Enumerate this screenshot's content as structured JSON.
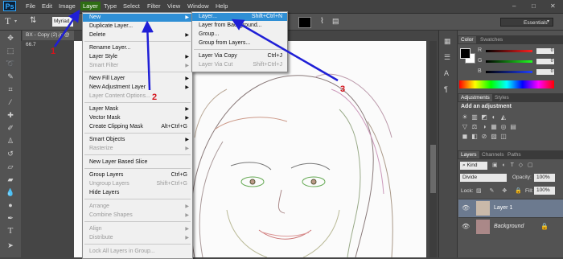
{
  "app": {
    "logo": "Ps"
  },
  "menubar": {
    "items": [
      "File",
      "Edit",
      "Image",
      "Layer",
      "Type",
      "Select",
      "Filter",
      "View",
      "Window",
      "Help"
    ],
    "window_controls": [
      "–",
      "□",
      "✕"
    ]
  },
  "options": {
    "font_value": "Myriad",
    "workspace": "Essentials"
  },
  "document": {
    "tab_label": "BX - Copy (2).jp @ 66.7"
  },
  "layer_menu": {
    "items": [
      {
        "label": "New",
        "shortcut": "",
        "submenu": true,
        "state": "highlight"
      },
      {
        "label": "Duplicate Layer...",
        "shortcut": "",
        "submenu": false,
        "state": "normal"
      },
      {
        "label": "Delete",
        "shortcut": "",
        "submenu": true,
        "state": "normal"
      },
      {
        "label": "Rename Layer...",
        "shortcut": "",
        "submenu": false,
        "state": "normal"
      },
      {
        "label": "Layer Style",
        "shortcut": "",
        "submenu": true,
        "state": "normal"
      },
      {
        "label": "Smart Filter",
        "shortcut": "",
        "submenu": true,
        "state": "disabled"
      },
      {
        "label": "New Fill Layer",
        "shortcut": "",
        "submenu": true,
        "state": "normal"
      },
      {
        "label": "New Adjustment Layer",
        "shortcut": "",
        "submenu": true,
        "state": "normal"
      },
      {
        "label": "Layer Content Options...",
        "shortcut": "",
        "submenu": false,
        "state": "disabled"
      },
      {
        "label": "Layer Mask",
        "shortcut": "",
        "submenu": true,
        "state": "normal"
      },
      {
        "label": "Vector Mask",
        "shortcut": "",
        "submenu": true,
        "state": "normal"
      },
      {
        "label": "Create Clipping Mask",
        "shortcut": "Alt+Ctrl+G",
        "submenu": false,
        "state": "normal"
      },
      {
        "label": "Smart Objects",
        "shortcut": "",
        "submenu": true,
        "state": "normal"
      },
      {
        "label": "Rasterize",
        "shortcut": "",
        "submenu": true,
        "state": "disabled"
      },
      {
        "label": "New Layer Based Slice",
        "shortcut": "",
        "submenu": false,
        "state": "normal"
      },
      {
        "label": "Group Layers",
        "shortcut": "Ctrl+G",
        "submenu": false,
        "state": "normal"
      },
      {
        "label": "Ungroup Layers",
        "shortcut": "Shift+Ctrl+G",
        "submenu": false,
        "state": "disabled"
      },
      {
        "label": "Hide Layers",
        "shortcut": "",
        "submenu": false,
        "state": "normal"
      },
      {
        "label": "Arrange",
        "shortcut": "",
        "submenu": true,
        "state": "disabled"
      },
      {
        "label": "Combine Shapes",
        "shortcut": "",
        "submenu": true,
        "state": "disabled"
      },
      {
        "label": "Align",
        "shortcut": "",
        "submenu": true,
        "state": "disabled"
      },
      {
        "label": "Distribute",
        "shortcut": "",
        "submenu": true,
        "state": "disabled"
      },
      {
        "label": "Lock All Layers in Group...",
        "shortcut": "",
        "submenu": false,
        "state": "disabled"
      }
    ]
  },
  "new_submenu": {
    "items": [
      {
        "label": "Layer...",
        "shortcut": "Shift+Ctrl+N",
        "state": "highlight"
      },
      {
        "label": "Layer from Background...",
        "shortcut": "",
        "state": "normal"
      },
      {
        "label": "Group...",
        "shortcut": "",
        "state": "normal"
      },
      {
        "label": "Group from Layers...",
        "shortcut": "",
        "state": "normal"
      },
      {
        "label": "Layer Via Copy",
        "shortcut": "Ctrl+J",
        "state": "normal"
      },
      {
        "label": "Layer Via Cut",
        "shortcut": "Shift+Ctrl+J",
        "state": "disabled"
      }
    ]
  },
  "color_panel": {
    "tabs": [
      "Color",
      "Swatches"
    ],
    "sliders": [
      {
        "label": "R",
        "value": "0",
        "color": "#d83a3a"
      },
      {
        "label": "G",
        "value": "0",
        "color": "#3ac13a"
      },
      {
        "label": "B",
        "value": "0",
        "color": "#3a5bd8"
      }
    ]
  },
  "adjustments_panel": {
    "tabs": [
      "Adjustments",
      "Styles"
    ],
    "heading": "Add an adjustment",
    "icons": [
      "☀",
      "▥",
      "◩",
      "◐",
      "◭",
      "▽",
      "⚖",
      "◑",
      "▦",
      "◎",
      "▤",
      "◼",
      "◧",
      "⊘",
      "▨",
      "◫"
    ]
  },
  "layers_panel": {
    "tabs": [
      "Layers",
      "Channels",
      "Paths"
    ],
    "filter": "Kind",
    "blend_mode": "Divide",
    "opacity_label": "Opacity:",
    "opacity": "100%",
    "lock_label": "Lock:",
    "fill_label": "Fill:",
    "fill": "100%",
    "layers": [
      {
        "name": "Layer 1",
        "selected": true
      },
      {
        "name": "Background",
        "selected": false
      }
    ]
  },
  "annotations": [
    {
      "number": "1",
      "color": "#d4141c"
    },
    {
      "number": "2",
      "color": "#d4141c"
    },
    {
      "number": "3",
      "color": "#d4141c"
    }
  ],
  "arrow_color": "#1f1fd6"
}
